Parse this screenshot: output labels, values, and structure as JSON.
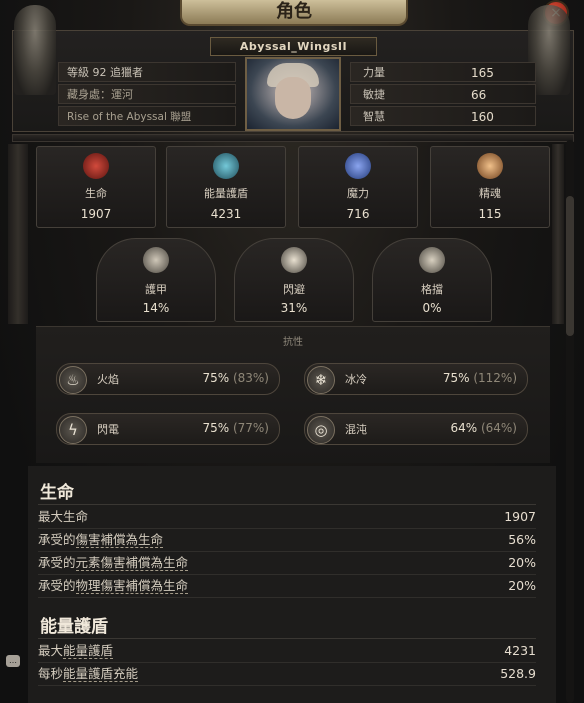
{
  "window": {
    "title": "角色",
    "close_label": "×"
  },
  "character": {
    "name": "Abyssal_WingsII",
    "level_label": "等級 92 追獵者",
    "hideout_label": "藏身處：運河",
    "league_label": "Rise of the Abyssal 聯盟"
  },
  "attributes": [
    {
      "label": "力量",
      "value": "165"
    },
    {
      "label": "敏捷",
      "value": "66"
    },
    {
      "label": "智慧",
      "value": "160"
    }
  ],
  "main_stats": [
    {
      "label": "生命",
      "value": "1907",
      "icon": "heart-icon",
      "color": "#b3322a"
    },
    {
      "label": "能量護盾",
      "value": "4231",
      "icon": "shield-icon",
      "color": "#4fa6b8"
    },
    {
      "label": "魔力",
      "value": "716",
      "icon": "mana-icon",
      "color": "#4e6fcf"
    },
    {
      "label": "精魂",
      "value": "115",
      "icon": "spirit-icon",
      "color": "#d9a36b"
    }
  ],
  "defense_stats": [
    {
      "label": "護甲",
      "value": "14%",
      "icon": "armour-icon"
    },
    {
      "label": "閃避",
      "value": "31%",
      "icon": "evasion-icon"
    },
    {
      "label": "格擋",
      "value": "0%",
      "icon": "block-icon"
    }
  ],
  "resistances": {
    "title": "抗性",
    "items": [
      {
        "label": "火焰",
        "value": "75%",
        "max": "(83%)",
        "icon": "fire-icon",
        "glyph": "♨"
      },
      {
        "label": "冰冷",
        "value": "75%",
        "max": "(112%)",
        "icon": "cold-icon",
        "glyph": "❄"
      },
      {
        "label": "閃電",
        "value": "75%",
        "max": "(77%)",
        "icon": "lightning-icon",
        "glyph": "ϟ"
      },
      {
        "label": "混沌",
        "value": "64%",
        "max": "(64%)",
        "icon": "chaos-icon",
        "glyph": "◎"
      }
    ]
  },
  "life_section": {
    "title": "生命",
    "rows": [
      {
        "key": "最大生命",
        "value": "1907"
      },
      {
        "key_pre": "承受的",
        "key_u": "傷害補償為生命",
        "key_post": "",
        "value": "56%"
      },
      {
        "key_pre": "承受的",
        "key_u": "元素傷害補償為生命",
        "key_post": "",
        "value": "20%"
      },
      {
        "key_pre": "承受的",
        "key_u": "物理傷害補償為生命",
        "key_post": "",
        "value": "20%"
      }
    ]
  },
  "es_section": {
    "title": "能量護盾",
    "rows": [
      {
        "key_pre": "最大",
        "key_u": "能量護盾",
        "value": "4231"
      },
      {
        "key_pre": "每秒",
        "key_u": "能量護盾充能",
        "value": "528.9"
      }
    ]
  }
}
